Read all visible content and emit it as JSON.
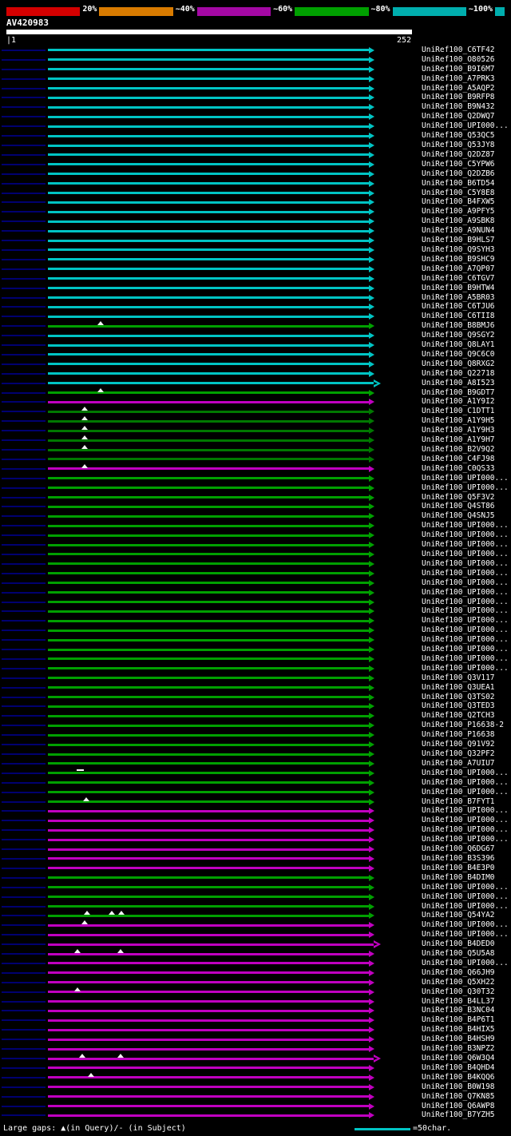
{
  "legend": {
    "segments": [
      {
        "label": "20%",
        "color": "#d40000"
      },
      {
        "label": "~40%",
        "color": "#d97b00"
      },
      {
        "label": "~60%",
        "color": "#a408a4"
      },
      {
        "label": "~80%",
        "color": "#00a000"
      },
      {
        "label": "~100%",
        "color": "#00aeae"
      }
    ]
  },
  "query": {
    "name": "AV420983",
    "start_label": "|1",
    "end_label": "252"
  },
  "footer": {
    "gaps_text": "Large gaps: ▲(in Query)/- (in Subject)",
    "scale_text": "=50char."
  },
  "colors": {
    "cyan": "#00c4c4",
    "green": "#00a000",
    "dgreen": "#007800",
    "magenta": "#c000c0",
    "gutter": "#000070",
    "marker": "#f2f2f2",
    "query_bar": "#ffffff"
  },
  "rows": [
    {
      "l": "UniRef100_C6TF42",
      "c": "cyan"
    },
    {
      "l": "UniRef100_O80526",
      "c": "cyan"
    },
    {
      "l": "UniRef100_B9I6M7",
      "c": "cyan"
    },
    {
      "l": "UniRef100_A7PRK3",
      "c": "cyan"
    },
    {
      "l": "UniRef100_A5AQP2",
      "c": "cyan"
    },
    {
      "l": "UniRef100_B9RFP8",
      "c": "cyan"
    },
    {
      "l": "UniRef100_B9N432",
      "c": "cyan"
    },
    {
      "l": "UniRef100_Q2DWQ7",
      "c": "cyan"
    },
    {
      "l": "UniRef100_UPI000...",
      "c": "cyan"
    },
    {
      "l": "UniRef100_Q53QC5",
      "c": "cyan"
    },
    {
      "l": "UniRef100_Q53JY8",
      "c": "cyan"
    },
    {
      "l": "UniRef100_Q2DZ87",
      "c": "cyan"
    },
    {
      "l": "UniRef100_C5YPW6",
      "c": "cyan"
    },
    {
      "l": "UniRef100_Q2DZB6",
      "c": "cyan"
    },
    {
      "l": "UniRef100_B6TD54",
      "c": "cyan"
    },
    {
      "l": "UniRef100_C5Y8E8",
      "c": "cyan"
    },
    {
      "l": "UniRef100_B4FXW5",
      "c": "cyan"
    },
    {
      "l": "UniRef100_A9PFY5",
      "c": "cyan"
    },
    {
      "l": "UniRef100_A9SBK8",
      "c": "cyan"
    },
    {
      "l": "UniRef100_A9NUN4",
      "c": "cyan"
    },
    {
      "l": "UniRef100_B9HLS7",
      "c": "cyan"
    },
    {
      "l": "UniRef100_Q9SYH3",
      "c": "cyan"
    },
    {
      "l": "UniRef100_B9SHC9",
      "c": "cyan"
    },
    {
      "l": "UniRef100_A7QP07",
      "c": "cyan"
    },
    {
      "l": "UniRef100_C6TGV7",
      "c": "cyan"
    },
    {
      "l": "UniRef100_B9HTW4",
      "c": "cyan"
    },
    {
      "l": "UniRef100_A5BR03",
      "c": "cyan"
    },
    {
      "l": "UniRef100_C6TJU6",
      "c": "cyan"
    },
    {
      "l": "UniRef100_C6TII8",
      "c": "cyan"
    },
    {
      "l": "UniRef100_B8BMJ6",
      "c": "green",
      "t": [
        0.165
      ]
    },
    {
      "l": "UniRef100_Q9SGY2",
      "c": "cyan"
    },
    {
      "l": "UniRef100_Q8LAY1",
      "c": "cyan"
    },
    {
      "l": "UniRef100_Q9C6C0",
      "c": "cyan"
    },
    {
      "l": "UniRef100_Q8RXG2",
      "c": "cyan"
    },
    {
      "l": "UniRef100_Q22718",
      "c": "cyan"
    },
    {
      "l": "UniRef100_A8I523",
      "c": "cyan",
      "o": true
    },
    {
      "l": "UniRef100_B9GDT7",
      "c": "green",
      "t": [
        0.165
      ]
    },
    {
      "l": "UniRef100_A1Y9I2",
      "c": "magenta"
    },
    {
      "l": "UniRef100_C1DTT1",
      "c": "dgreen",
      "t": [
        0.115
      ]
    },
    {
      "l": "UniRef100_A1Y9H5",
      "c": "dgreen",
      "t": [
        0.115
      ]
    },
    {
      "l": "UniRef100_A1Y9H3",
      "c": "dgreen",
      "t": [
        0.115
      ]
    },
    {
      "l": "UniRef100_A1Y9H7",
      "c": "dgreen",
      "t": [
        0.115
      ]
    },
    {
      "l": "UniRef100_B2V9Q2",
      "c": "dgreen",
      "t": [
        0.115
      ]
    },
    {
      "l": "UniRef100_C4FJ98",
      "c": "dgreen"
    },
    {
      "l": "UniRef100_C0QS33",
      "c": "magenta",
      "t": [
        0.115
      ]
    },
    {
      "l": "UniRef100_UPI000...",
      "c": "green"
    },
    {
      "l": "UniRef100_UPI000...",
      "c": "green"
    },
    {
      "l": "UniRef100_Q5F3V2",
      "c": "green"
    },
    {
      "l": "UniRef100_Q4ST86",
      "c": "green"
    },
    {
      "l": "UniRef100_Q4SNJ5",
      "c": "green"
    },
    {
      "l": "UniRef100_UPI000...",
      "c": "green"
    },
    {
      "l": "UniRef100_UPI000...",
      "c": "green"
    },
    {
      "l": "UniRef100_UPI000...",
      "c": "green"
    },
    {
      "l": "UniRef100_UPI000...",
      "c": "green"
    },
    {
      "l": "UniRef100_UPI000...",
      "c": "green"
    },
    {
      "l": "UniRef100_UPI000...",
      "c": "green"
    },
    {
      "l": "UniRef100_UPI000...",
      "c": "green"
    },
    {
      "l": "UniRef100_UPI000...",
      "c": "green"
    },
    {
      "l": "UniRef100_UPI000...",
      "c": "green"
    },
    {
      "l": "UniRef100_UPI000...",
      "c": "green"
    },
    {
      "l": "UniRef100_UPI000...",
      "c": "green"
    },
    {
      "l": "UniRef100_UPI000...",
      "c": "green"
    },
    {
      "l": "UniRef100_UPI000...",
      "c": "green"
    },
    {
      "l": "UniRef100_UPI000...",
      "c": "green"
    },
    {
      "l": "UniRef100_UPI000...",
      "c": "green"
    },
    {
      "l": "UniRef100_UPI000...",
      "c": "green"
    },
    {
      "l": "UniRef100_Q3V117",
      "c": "green"
    },
    {
      "l": "UniRef100_Q3UEA1",
      "c": "green"
    },
    {
      "l": "UniRef100_Q3TS02",
      "c": "green"
    },
    {
      "l": "UniRef100_Q3TED3",
      "c": "green"
    },
    {
      "l": "UniRef100_Q2TCH3",
      "c": "green"
    },
    {
      "l": "UniRef100_P16638-2",
      "c": "green"
    },
    {
      "l": "UniRef100_P16638",
      "c": "green"
    },
    {
      "l": "UniRef100_Q91V92",
      "c": "green"
    },
    {
      "l": "UniRef100_Q32PF2",
      "c": "green"
    },
    {
      "l": "UniRef100_A7UIU7",
      "c": "green"
    },
    {
      "l": "UniRef100_UPI000...",
      "c": "green",
      "g": [
        0.1
      ]
    },
    {
      "l": "UniRef100_UPI000...",
      "c": "green"
    },
    {
      "l": "UniRef100_UPI000...",
      "c": "green"
    },
    {
      "l": "UniRef100_B7FYT1",
      "c": "green",
      "t": [
        0.12
      ]
    },
    {
      "l": "UniRef100_UPI000...",
      "c": "magenta"
    },
    {
      "l": "UniRef100_UPI000...",
      "c": "magenta"
    },
    {
      "l": "UniRef100_UPI000...",
      "c": "magenta"
    },
    {
      "l": "UniRef100_UPI000...",
      "c": "magenta"
    },
    {
      "l": "UniRef100_Q6DG67",
      "c": "magenta"
    },
    {
      "l": "UniRef100_B3S396",
      "c": "magenta"
    },
    {
      "l": "UniRef100_B4E3P0",
      "c": "magenta"
    },
    {
      "l": "UniRef100_B4DIM0",
      "c": "green"
    },
    {
      "l": "UniRef100_UPI000...",
      "c": "green"
    },
    {
      "l": "UniRef100_UPI000...",
      "c": "green"
    },
    {
      "l": "UniRef100_UPI000...",
      "c": "green"
    },
    {
      "l": "UniRef100_Q54YA2",
      "c": "green",
      "t": [
        0.123,
        0.199,
        0.229
      ]
    },
    {
      "l": "UniRef100_UPI000...",
      "c": "magenta",
      "t": [
        0.115
      ]
    },
    {
      "l": "UniRef100_UPI000...",
      "c": "magenta"
    },
    {
      "l": "UniRef100_B4DED0",
      "c": "magenta",
      "o": true
    },
    {
      "l": "UniRef100_Q5U5A8",
      "c": "magenta",
      "t": [
        0.093,
        0.226
      ]
    },
    {
      "l": "UniRef100_UPI000...",
      "c": "magenta"
    },
    {
      "l": "UniRef100_Q66JH9",
      "c": "magenta"
    },
    {
      "l": "UniRef100_Q5XH22",
      "c": "magenta"
    },
    {
      "l": "UniRef100_Q30T32",
      "c": "magenta",
      "t": [
        0.093
      ]
    },
    {
      "l": "UniRef100_B4LL37",
      "c": "magenta"
    },
    {
      "l": "UniRef100_B3NC04",
      "c": "magenta"
    },
    {
      "l": "UniRef100_B4P6T1",
      "c": "magenta"
    },
    {
      "l": "UniRef100_B4HIX5",
      "c": "magenta"
    },
    {
      "l": "UniRef100_B4HSH9",
      "c": "magenta"
    },
    {
      "l": "UniRef100_B3NPZ2",
      "c": "magenta"
    },
    {
      "l": "UniRef100_Q6W3Q4",
      "c": "magenta",
      "o": true,
      "t": [
        0.106,
        0.226
      ]
    },
    {
      "l": "UniRef100_B4QHD4",
      "c": "magenta"
    },
    {
      "l": "UniRef100_B4KQQ6",
      "c": "magenta",
      "t": [
        0.135
      ]
    },
    {
      "l": "UniRef100_B0W198",
      "c": "magenta"
    },
    {
      "l": "UniRef100_Q7KN85",
      "c": "magenta"
    },
    {
      "l": "UniRef100_Q6AWP8",
      "c": "magenta"
    },
    {
      "l": "UniRef100_B7YZH5",
      "c": "magenta"
    }
  ]
}
